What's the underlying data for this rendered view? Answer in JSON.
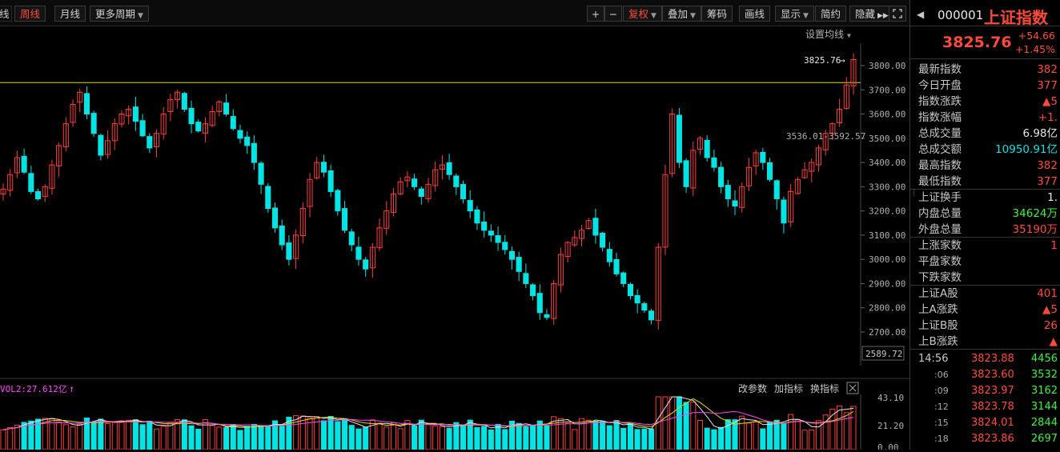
{
  "toolbar": {
    "edge_label": "线",
    "tabs": [
      {
        "label": "周线",
        "active": true
      },
      {
        "label": "月线",
        "active": false
      },
      {
        "label": "更多周期",
        "active": false,
        "dropdown": true
      }
    ],
    "right_buttons": [
      {
        "label": "+"
      },
      {
        "label": "−"
      },
      {
        "label": "复权",
        "active": true,
        "dropdown": true
      },
      {
        "label": "叠加",
        "dropdown": true
      },
      {
        "label": "筹码"
      },
      {
        "label": "画线"
      },
      {
        "label": "显示",
        "dropdown": true
      },
      {
        "label": "简约"
      },
      {
        "label": "隐藏"
      }
    ]
  },
  "chart": {
    "set_ma_label": "设置均线",
    "current_price_label": "3825.76",
    "range_label": "3536.01-3592.57",
    "lowest_price_label": "2589.72",
    "price_axis": [
      "3800.00",
      "3700.00",
      "3600.00",
      "3500.00",
      "3400.00",
      "3300.00",
      "3200.00",
      "3100.00",
      "3000.00",
      "2900.00",
      "2800.00",
      "2700.00"
    ],
    "hline_value": 3730,
    "colors": {
      "up": "#ff3b3b",
      "down": "#00e4e4",
      "hline": "#e6d800",
      "axis": "#b0b0b0",
      "grid": "#222222"
    }
  },
  "indicator": {
    "vol_label": "VOL2:27.612亿",
    "buttons": [
      "改参数",
      "加指标",
      "换指标"
    ],
    "close_icon": "close-icon",
    "axis": [
      "43.10",
      "21.20",
      "0.00"
    ]
  },
  "chart_data": {
    "type": "candlestick",
    "title": "上证指数",
    "period": "周线",
    "ylim": [
      2589.72,
      3850
    ],
    "closes": [
      3290,
      3350,
      3420,
      3360,
      3280,
      3250,
      3300,
      3390,
      3470,
      3560,
      3640,
      3690,
      3600,
      3520,
      3430,
      3490,
      3560,
      3600,
      3620,
      3570,
      3510,
      3460,
      3520,
      3600,
      3660,
      3690,
      3620,
      3560,
      3530,
      3560,
      3610,
      3650,
      3600,
      3540,
      3500,
      3470,
      3400,
      3310,
      3210,
      3130,
      3060,
      3000,
      3100,
      3210,
      3330,
      3400,
      3360,
      3280,
      3200,
      3120,
      3060,
      3000,
      2960,
      3050,
      3130,
      3200,
      3270,
      3320,
      3340,
      3300,
      3260,
      3310,
      3370,
      3390,
      3350,
      3300,
      3250,
      3200,
      3150,
      3120,
      3100,
      3070,
      3040,
      3000,
      2950,
      2900,
      2850,
      2780,
      2760,
      2900,
      3020,
      3070,
      3090,
      3120,
      3160,
      3100,
      3050,
      2990,
      2940,
      2900,
      2850,
      2820,
      2790,
      2750,
      3050,
      3350,
      3600,
      3400,
      3300,
      3450,
      3500,
      3420,
      3380,
      3300,
      3250,
      3220,
      3300,
      3380,
      3440,
      3400,
      3330,
      3250,
      3150,
      3280,
      3330,
      3370,
      3400,
      3460,
      3520,
      3560,
      3620,
      3720,
      3825
    ],
    "volume_axis_max": 43.1,
    "vol2_value": "27.612亿"
  },
  "quote": {
    "code": "000001",
    "name": "上证指数",
    "price": "3825.76",
    "change": "+54.66",
    "change_pct": "+1.45%",
    "rows": [
      {
        "label": "最新指数",
        "value": "382",
        "color": "red"
      },
      {
        "label": "今日开盘",
        "value": "377",
        "color": "red"
      },
      {
        "label": "指数涨跌",
        "value": "▲5",
        "color": "red"
      },
      {
        "label": "指数涨幅",
        "value": "+1.",
        "color": "red"
      },
      {
        "label": "总成交量",
        "value": "6.98亿",
        "color": "white"
      },
      {
        "label": "总成交额",
        "value": "10950.91亿",
        "color": "cyan"
      },
      {
        "label": "最高指数",
        "value": "382",
        "color": "red"
      },
      {
        "label": "最低指数",
        "value": "377",
        "color": "red"
      }
    ],
    "rows2": [
      {
        "label": "上证换手",
        "value": "1.",
        "color": "white"
      },
      {
        "label": "内盘总量",
        "value": "34624万",
        "color": "green"
      },
      {
        "label": "外盘总量",
        "value": "35190万",
        "color": "red"
      }
    ],
    "rows3": [
      {
        "label": "上涨家数",
        "value": "1",
        "color": "red"
      },
      {
        "label": "平盘家数",
        "value": "",
        "color": "white"
      },
      {
        "label": "下跌家数",
        "value": "",
        "color": "white"
      }
    ],
    "rows4": [
      {
        "label": "上证A股",
        "value": "401",
        "color": "red"
      },
      {
        "label": "上A涨跌",
        "value": "▲5",
        "color": "red"
      },
      {
        "label": "上证B股",
        "value": "26",
        "color": "red"
      },
      {
        "label": "上B涨跌",
        "value": "▲",
        "color": "red"
      }
    ],
    "ticks": [
      {
        "time": "14:56",
        "price": "3823.88",
        "vol": "4456"
      },
      {
        "time": ":06",
        "price": "3823.60",
        "vol": "3532"
      },
      {
        "time": ":09",
        "price": "3823.97",
        "vol": "3162"
      },
      {
        "time": ":12",
        "price": "3823.78",
        "vol": "3144"
      },
      {
        "time": ":15",
        "price": "3824.01",
        "vol": "2844"
      },
      {
        "time": ":18",
        "price": "3823.86",
        "vol": "2697"
      }
    ]
  }
}
